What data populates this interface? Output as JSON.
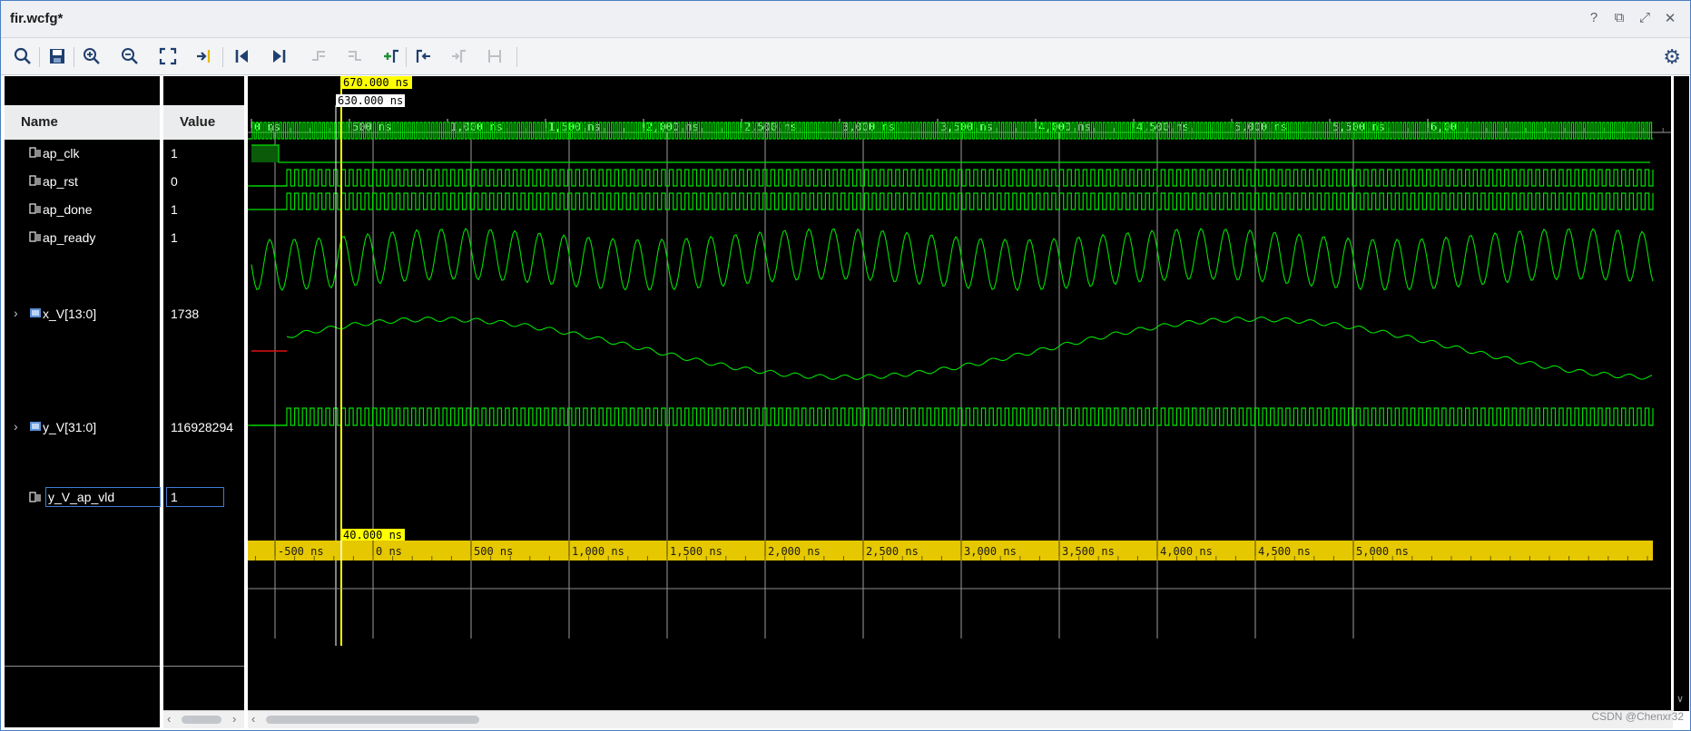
{
  "window": {
    "title": "fir.wcfg*",
    "controls": [
      "?",
      "⧉",
      "⤢",
      "✕"
    ]
  },
  "toolbar": {
    "buttons": [
      "search-icon",
      "save-icon",
      "zoom-in-icon",
      "zoom-out-icon",
      "zoom-fit-icon",
      "go-to-cursor-icon",
      "go-to-time-zero-icon",
      "go-to-last-time-icon",
      "previous-transition-icon",
      "next-transition-icon",
      "add-marker-icon",
      "previous-marker-icon",
      "next-marker-icon",
      "swap-cursors-icon"
    ],
    "settings_icon": "gear-icon"
  },
  "columns": {
    "name_header": "Name",
    "value_header": "Value"
  },
  "signals": [
    {
      "name": "ap_clk",
      "value": "1",
      "type": "bit",
      "expandable": false
    },
    {
      "name": "ap_rst",
      "value": "0",
      "type": "bit",
      "expandable": false
    },
    {
      "name": "ap_done",
      "value": "1",
      "type": "bit",
      "expandable": false
    },
    {
      "name": "ap_ready",
      "value": "1",
      "type": "bit",
      "expandable": false
    },
    {
      "name": "x_V[13:0]",
      "value": "1738",
      "type": "bus",
      "expandable": true
    },
    {
      "name": "y_V[31:0]",
      "value": "116928294",
      "type": "bus",
      "expandable": true
    },
    {
      "name": "y_V_ap_vld",
      "value": "1",
      "type": "bit",
      "expandable": false,
      "selected": true
    }
  ],
  "cursors": {
    "primary_label": "670.000 ns",
    "secondary_label": "630.000 ns",
    "delta_label": "40.000 ns"
  },
  "time_ruler": {
    "labels": [
      "0 ns",
      "500 ns",
      "1,000 ns",
      "1,500 ns",
      "2,000 ns",
      "2,500 ns",
      "3,000 ns",
      "3,500 ns",
      "4,000 ns",
      "4,500 ns",
      "5,000 ns",
      "5,500 ns",
      "6,00"
    ]
  },
  "relative_ruler": {
    "labels": [
      "-500 ns",
      "0 ns",
      "500 ns",
      "1,000 ns",
      "1,500 ns",
      "2,000 ns",
      "2,500 ns",
      "3,000 ns",
      "3,500 ns",
      "4,000 ns",
      "4,500 ns",
      "5,000 ns"
    ]
  },
  "colors": {
    "wave": "#00e000",
    "cursor": "#ffff00",
    "ruler_bg": "#e6c800",
    "reset_bus": "#e01010"
  },
  "watermark": "CSDN @Chenxr32"
}
